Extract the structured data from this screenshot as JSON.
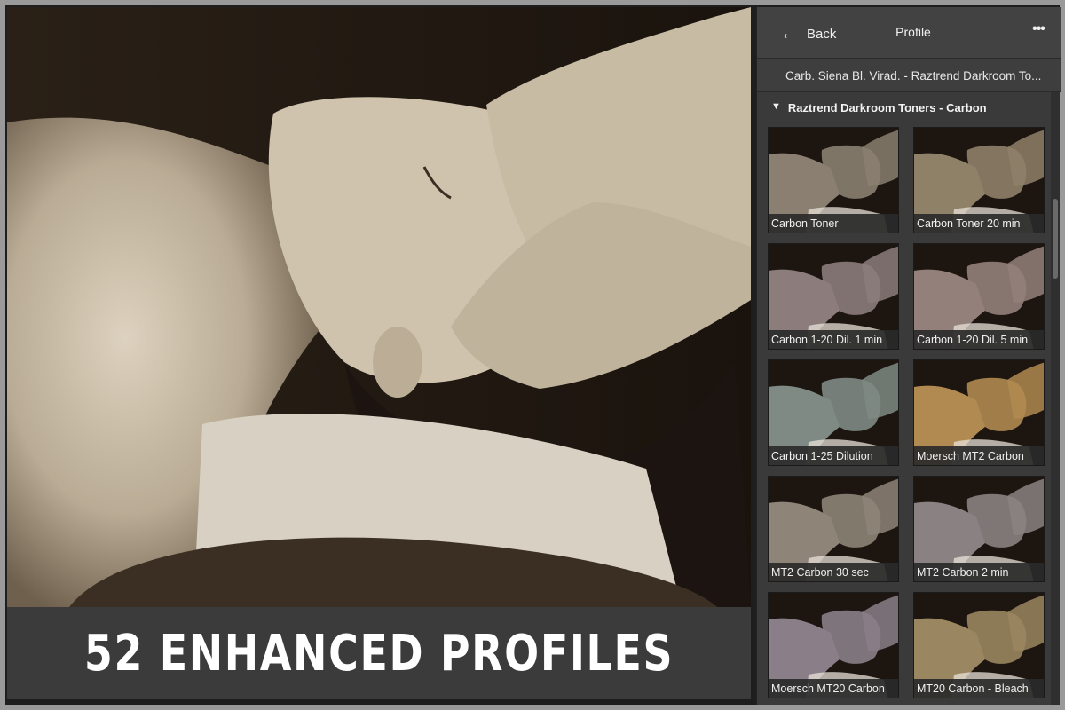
{
  "caption": "52 ENHANCED PROFILES",
  "panel": {
    "back_label": "Back",
    "title": "Profile",
    "more_label": "•••",
    "current_profile": "Carb. Siena Bl. Virad. - Raztrend Darkroom To...",
    "group_name": "Raztrend Darkroom Toners - Carbon",
    "group_arrow": "▼"
  },
  "tiles": [
    {
      "label": "Carbon Toner",
      "tint": "#8a7f70"
    },
    {
      "label": "Carbon Toner 20 min",
      "tint": "#8f8068"
    },
    {
      "label": "Carbon 1-20 Dil. 1 min",
      "tint": "#8c7c7c"
    },
    {
      "label": "Carbon 1-20 Dil. 5 min",
      "tint": "#94807a"
    },
    {
      "label": "Carbon 1-25 Dilution",
      "tint": "#7f8a84"
    },
    {
      "label": "Moersch MT2 Carbon",
      "tint": "#b08a50"
    },
    {
      "label": "MT2 Carbon 30 sec",
      "tint": "#8e8478"
    },
    {
      "label": "MT2 Carbon 2 min",
      "tint": "#8a8282"
    },
    {
      "label": "Moersch MT20 Carbon",
      "tint": "#8a7f88"
    },
    {
      "label": "MT20 Carbon - Bleach",
      "tint": "#9a8660"
    }
  ]
}
